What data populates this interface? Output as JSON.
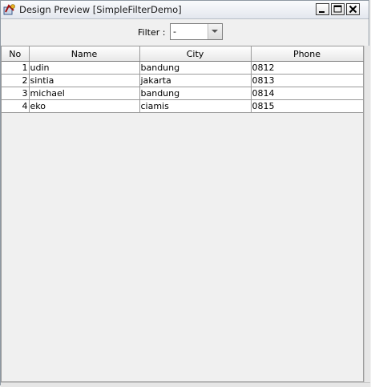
{
  "window": {
    "title": "Design Preview [SimpleFilterDemo]",
    "icons": [
      "app-icon",
      "minimize-icon",
      "maximize-icon",
      "close-icon"
    ]
  },
  "filter": {
    "label": "Filter :",
    "selected": "-"
  },
  "table": {
    "columns": [
      "No",
      "Name",
      "City",
      "Phone"
    ],
    "rows": [
      [
        "1",
        "udin",
        "bandung",
        "0812"
      ],
      [
        "2",
        "sintia",
        "jakarta",
        "0813"
      ],
      [
        "3",
        "michael",
        "bandung",
        "0814"
      ],
      [
        "4",
        "eko",
        "ciamis",
        "0815"
      ]
    ]
  }
}
